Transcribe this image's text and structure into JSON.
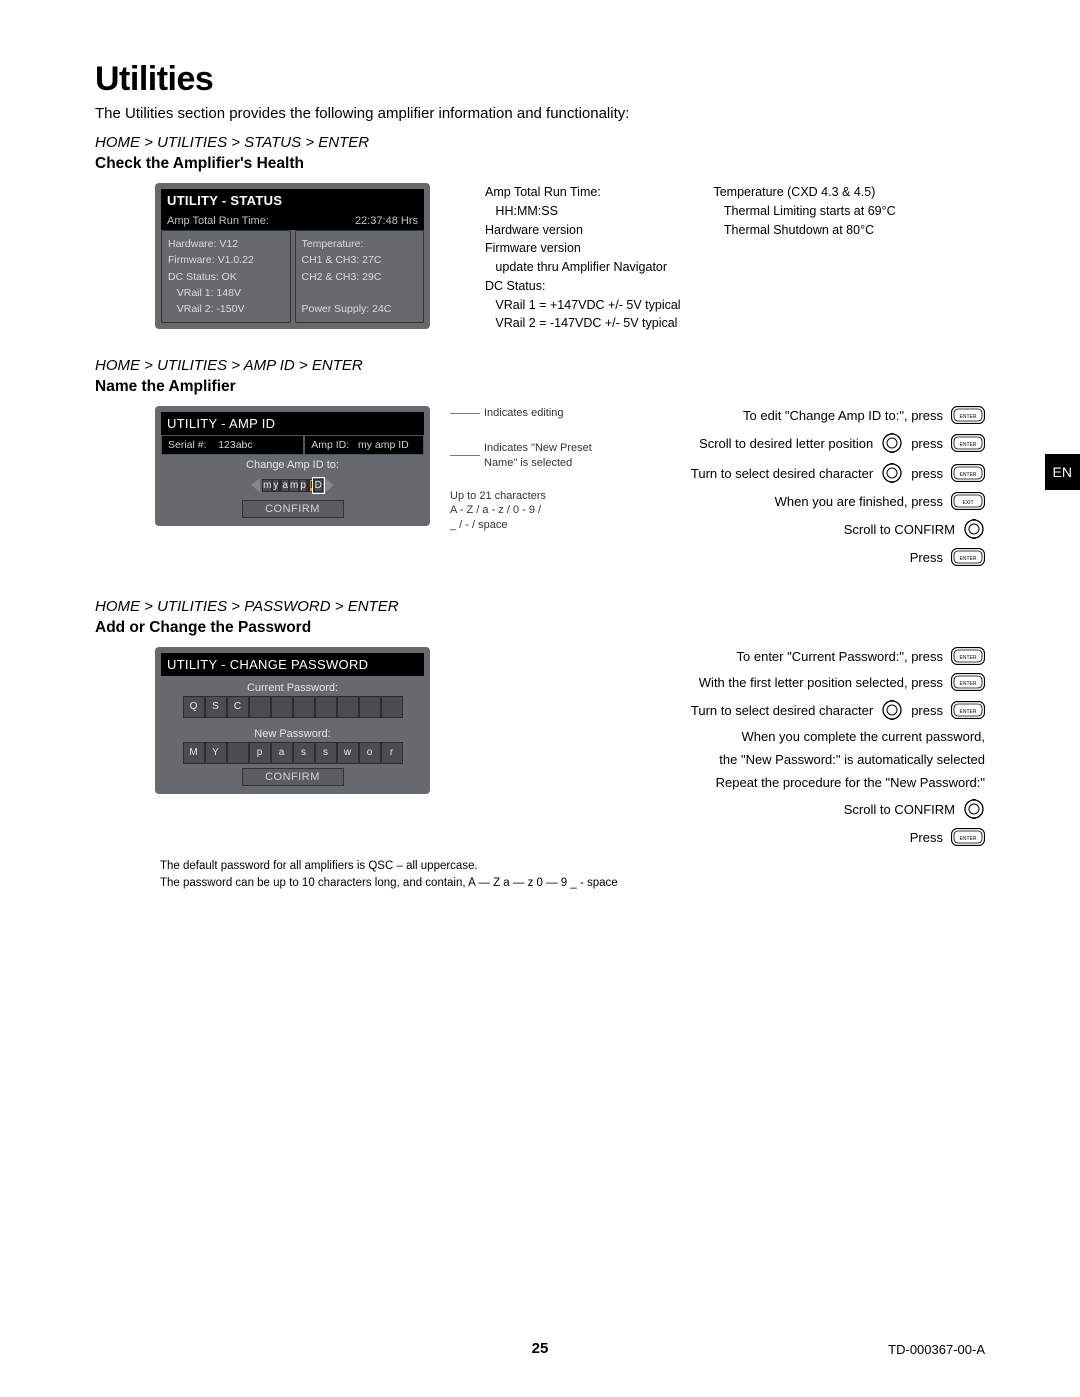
{
  "page": {
    "title": "Utilities",
    "intro": "The Utilities section provides the following amplifier information and functionality:",
    "number": "25",
    "doc_id": "TD-000367-00-A",
    "lang_tab": "EN"
  },
  "status": {
    "breadcrumb": "HOME > UTILITIES > STATUS > ENTER",
    "subhead": "Check the Amplifier's Health",
    "lcd": {
      "title": "UTILITY - STATUS",
      "runtime_label": "Amp Total Run Time:",
      "runtime_value": "22:37:48 Hrs",
      "left": [
        "Hardware: V12",
        "Firmware: V1.0.22",
        "DC Status:  OK",
        "   VRail 1: 148V",
        "   VRail 2: -150V"
      ],
      "right": [
        "Temperature:",
        "CH1 & CH3:  27C",
        "CH2 & CH3:  29C",
        "",
        "Power Supply:  24C"
      ]
    },
    "info": {
      "col1": [
        "Amp Total Run Time:",
        "   HH:MM:SS",
        "Hardware version",
        "Firmware version",
        "   update thru Amplifier Navigator",
        "DC Status:",
        "   VRail 1 = +147VDC  +/- 5V typical",
        "   VRail 2 = -147VDC  +/- 5V typical"
      ],
      "col2": [
        "Temperature (CXD 4.3 & 4.5)",
        "   Thermal Limiting starts at 69°C",
        "   Thermal Shutdown at 80°C"
      ]
    }
  },
  "ampid": {
    "breadcrumb": "HOME > UTILITIES > AMP ID > ENTER",
    "subhead": "Name the Amplifier",
    "lcd": {
      "title": "UTILITY - AMP ID",
      "serial_label": "Serial #:",
      "serial_value": "123abc",
      "ampid_label": "Amp ID:",
      "ampid_value": "my amp ID",
      "change_label": "Change Amp ID to:",
      "chars": [
        "m",
        "y",
        "",
        "a",
        "m",
        "p",
        "",
        "I",
        "D"
      ],
      "highlight_index": 7,
      "selected_index": 8,
      "confirm": "CONFIRM"
    },
    "callouts": {
      "editing": "Indicates editing",
      "newname": "Indicates \"New Preset Name\" is selected",
      "limits1": "Up to 21 characters",
      "limits2": "A - Z / a - z / 0 - 9 /",
      "limits3": "_  / - / space"
    },
    "instr": [
      {
        "text": "To edit \"Change Amp ID to:\", press",
        "icon": "enter"
      },
      {
        "text": "Scroll to desired letter position",
        "icon": "dial",
        "text2": "press",
        "icon2": "enter"
      },
      {
        "text": "Turn to select desired character",
        "icon": "dial",
        "text2": "press",
        "icon2": "enter"
      },
      {
        "text": "When you are finished, press",
        "icon": "exit"
      },
      {
        "text": "Scroll to CONFIRM",
        "icon": "dial"
      },
      {
        "text": "Press",
        "icon": "enter"
      }
    ]
  },
  "password": {
    "breadcrumb": "HOME > UTILITIES > PASSWORD > ENTER",
    "subhead": "Add or Change the Password",
    "lcd": {
      "title": "UTILITY - CHANGE PASSWORD",
      "current_label": "Current Password:",
      "current_chars": [
        "Q",
        "S",
        "C",
        "",
        "",
        "",
        "",
        "",
        "",
        ""
      ],
      "new_label": "New Password:",
      "new_chars": [
        "M",
        "Y",
        "",
        "p",
        "a",
        "s",
        "s",
        "w",
        "o",
        "r"
      ],
      "confirm": "CONFIRM"
    },
    "instr": [
      {
        "text": "To enter \"Current Password:\", press",
        "icon": "enter"
      },
      {
        "text": "With the first letter position selected, press",
        "icon": "enter"
      },
      {
        "text": "Turn to select desired character",
        "icon": "dial",
        "text2": "press",
        "icon2": "enter"
      },
      {
        "text": "When you complete the current password,"
      },
      {
        "text": "the \"New Password:\" is automatically selected"
      },
      {
        "text": "Repeat the procedure for the \"New Password:\""
      },
      {
        "text": "Scroll to CONFIRM",
        "icon": "dial"
      },
      {
        "text": "Press",
        "icon": "enter"
      }
    ],
    "footnotes": [
      "The default password for all amplifiers is QSC – all uppercase.",
      "The password can be up to 10 characters long, and contain,  A — Z    a — z    0 — 9    _     -     space"
    ]
  }
}
